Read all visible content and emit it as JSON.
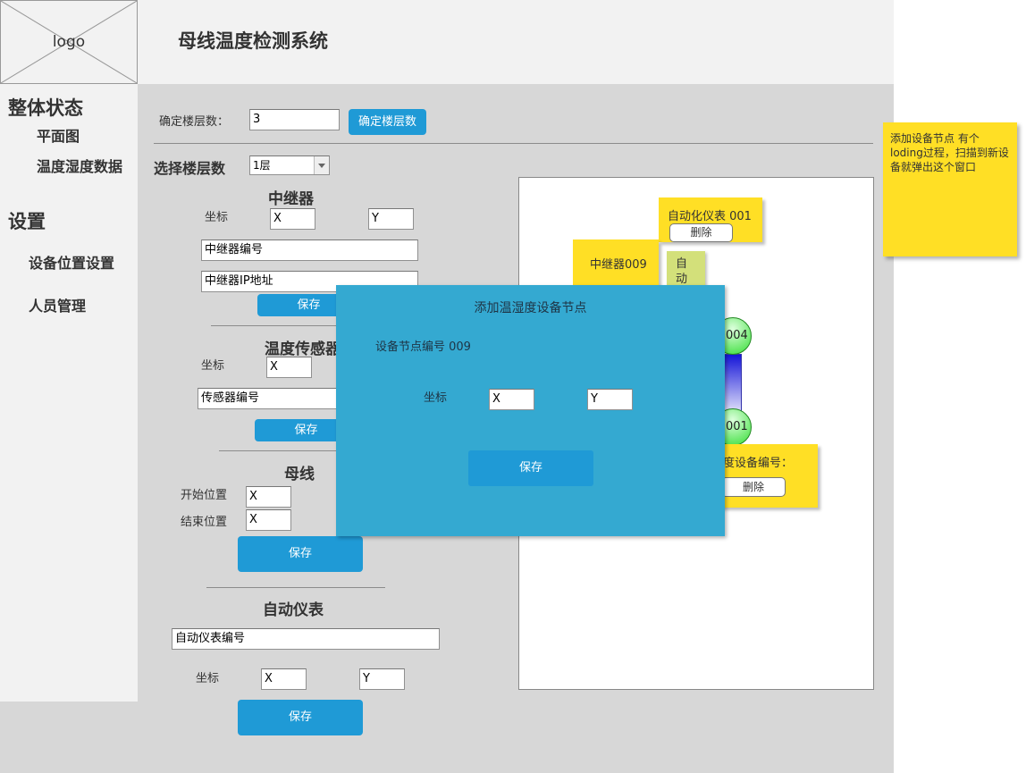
{
  "header": {
    "logo": "logo",
    "title": "母线温度检测系统"
  },
  "sidebar": {
    "group1": "整体状态",
    "item_plan": "平面图",
    "item_temp": "温度湿度数据",
    "group2": "设置",
    "item_device": "设备位置设置",
    "item_people": "人员管理"
  },
  "floor": {
    "count_label": "确定楼层数：",
    "count_value": "3",
    "confirm_button": "确定楼层数",
    "select_label": "选择楼层数",
    "select_value": "1层"
  },
  "repeater": {
    "title": "中继器",
    "coord_label": "坐标",
    "x": "X",
    "y": "Y",
    "id_placeholder": "中继器编号",
    "ip_placeholder": "中继器IP地址",
    "save": "保存"
  },
  "sensor": {
    "title": "温度传感器",
    "coord_label": "坐标",
    "x": "X",
    "id_placeholder": "传感器编号",
    "save": "保存"
  },
  "busbar": {
    "title": "母线",
    "start_label": "开始位置",
    "end_label": "结束位置",
    "start_x": "X",
    "end_x": "X",
    "save": "保存"
  },
  "meter": {
    "title": "自动仪表",
    "id_placeholder": "自动仪表编号",
    "coord_label": "坐标",
    "x": "X",
    "y": "Y",
    "save": "保存"
  },
  "canvas": {
    "meter_card_title": "自动化仪表 001",
    "meter_card_delete": "删除",
    "repeater_card_title": "中继器009",
    "green_card_text": "自动",
    "node_top": "004",
    "node_bottom": "001",
    "temp_card_title": "度设备编号：",
    "temp_card_delete": "删除"
  },
  "modal": {
    "title": "添加温湿度设备节点",
    "node_id": "设备节点编号 009",
    "coord_label": "坐标",
    "x": "X",
    "y": "Y",
    "save": "保存"
  },
  "note": {
    "text": "添加设备节点 有个loding过程，扫描到新设备就弹出这个窗口"
  },
  "colors": {
    "accent": "#1f9ad6",
    "modal": "#34a9d1",
    "sticky": "#ffdf25"
  }
}
